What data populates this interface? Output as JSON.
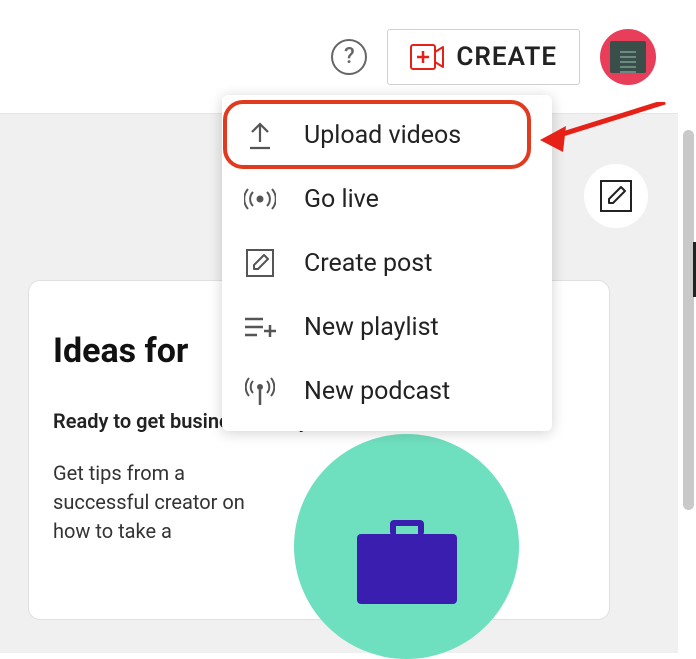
{
  "topbar": {
    "help_tooltip": "Help",
    "create_label": "CREATE"
  },
  "dropdown": {
    "items": [
      {
        "label": "Upload videos",
        "highlighted": true
      },
      {
        "label": "Go live"
      },
      {
        "label": "Create post"
      },
      {
        "label": "New playlist"
      },
      {
        "label": "New podcast"
      }
    ]
  },
  "card": {
    "title": "Ideas for",
    "subhead": "Ready to get business-savvy?",
    "body": "Get tips from a successful creator on how to take a"
  }
}
